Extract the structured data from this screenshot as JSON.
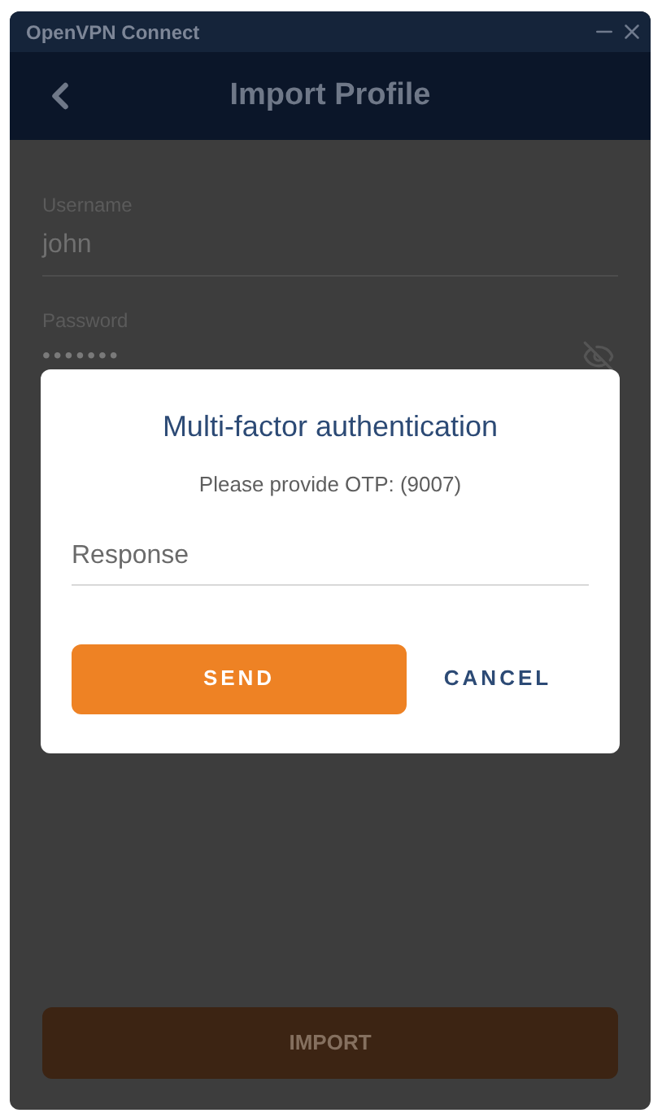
{
  "window": {
    "title": "OpenVPN Connect"
  },
  "header": {
    "title": "Import Profile"
  },
  "form": {
    "username": {
      "label": "Username",
      "value": "john"
    },
    "password": {
      "label": "Password",
      "value": "•••••••"
    }
  },
  "import_button": {
    "label": "IMPORT",
    "disabled": true
  },
  "dialog": {
    "title": "Multi-factor authentication",
    "message": "Please provide OTP: (9007)",
    "response": {
      "placeholder": "Response"
    },
    "buttons": [
      {
        "label": "SEND",
        "kind": "primary"
      },
      {
        "label": "CANCEL",
        "kind": "text"
      }
    ]
  }
}
